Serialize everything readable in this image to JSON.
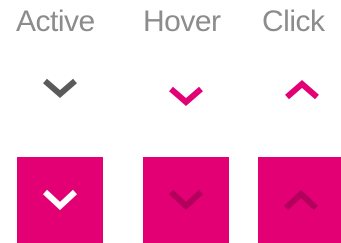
{
  "states": {
    "active": {
      "label": "Active"
    },
    "hover": {
      "label": "Hover"
    },
    "click": {
      "label": "Click"
    }
  },
  "icons": {
    "active_plain": "chevron-down-icon",
    "hover_plain": "chevron-down-icon",
    "click_plain": "chevron-up-icon",
    "active_tile": "chevron-down-icon",
    "hover_tile": "chevron-down-icon",
    "click_tile": "chevron-up-icon"
  },
  "colors": {
    "label_text": "#8c8c8c",
    "chevron_default": "#5a5a5a",
    "accent_magenta": "#e20074",
    "tile_chevron_active": "#ffffff",
    "tile_chevron_pressed": "#b3005c"
  }
}
